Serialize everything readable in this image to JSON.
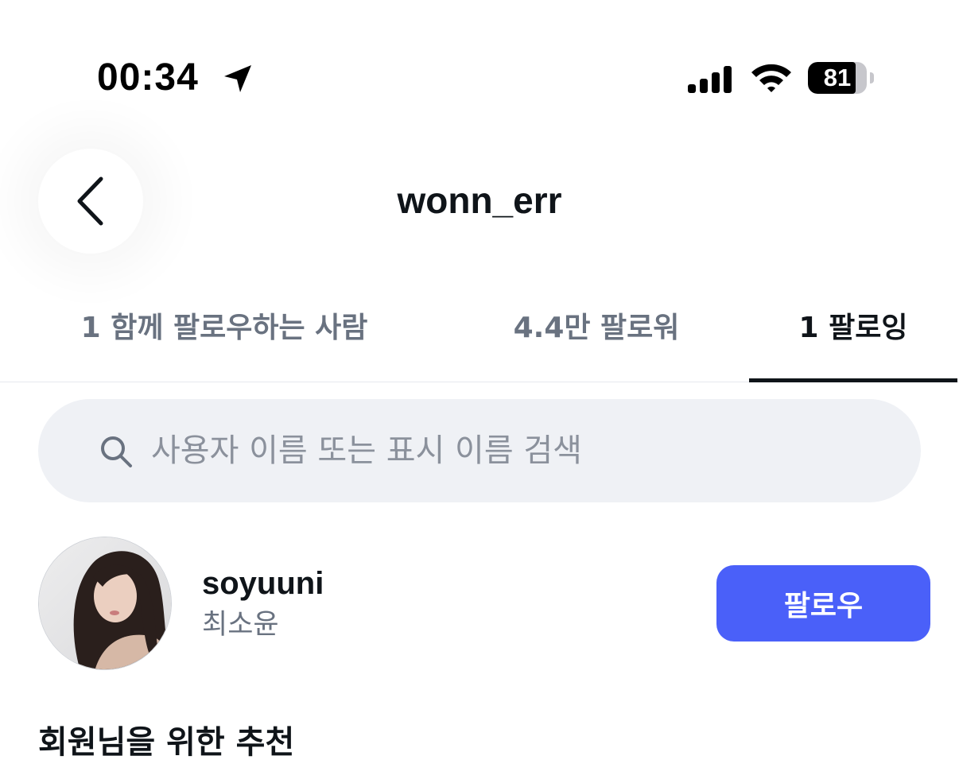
{
  "status_bar": {
    "time": "00:34",
    "battery": "81",
    "battery_level": 0.81,
    "icons": [
      "location-arrow-icon",
      "cellular-signal-icon",
      "wifi-icon",
      "battery-icon"
    ]
  },
  "header": {
    "title": "wonn_err",
    "back_icon": "chevron-left-icon"
  },
  "tabs": [
    {
      "label": "1 함께 팔로우하는 사람",
      "active": false
    },
    {
      "label": "4.4만 팔로워",
      "active": false
    },
    {
      "label": "1 팔로잉",
      "active": true
    }
  ],
  "search": {
    "icon": "search-icon",
    "placeholder": "사용자 이름 또는 표시 이름 검색",
    "value": ""
  },
  "users": [
    {
      "username": "soyuuni",
      "display_name": "최소윤",
      "button_label": "팔로우",
      "avatar": "avatar-photo"
    }
  ],
  "section": {
    "title": "회원님을 위한 추천"
  },
  "colors": {
    "accent": "#4a60f9",
    "text_primary": "#0f1419",
    "text_secondary": "#697280",
    "search_bg": "#eff1f5",
    "divider": "#e7e9ee"
  }
}
